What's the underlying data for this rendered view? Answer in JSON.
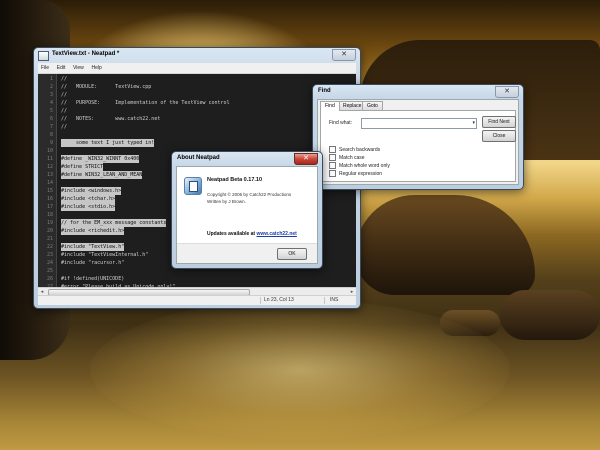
{
  "notepad": {
    "title": "TextView.txt - Neatpad *",
    "menu": [
      "File",
      "Edit",
      "View",
      "Help"
    ],
    "code_lines": [
      {
        "num": "1",
        "text": "//",
        "selected": false
      },
      {
        "num": "2",
        "text": "//   MODULE:      TextView.cpp",
        "selected": false
      },
      {
        "num": "3",
        "text": "//",
        "selected": false
      },
      {
        "num": "4",
        "text": "//   PURPOSE:     Implementation of the TextView control",
        "selected": false
      },
      {
        "num": "5",
        "text": "//",
        "selected": false
      },
      {
        "num": "6",
        "text": "//   NOTES:       www.catch22.net",
        "selected": false
      },
      {
        "num": "7",
        "text": "//",
        "selected": false
      },
      {
        "num": "8",
        "text": "",
        "selected": false
      },
      {
        "num": "9",
        "text": "     some text I just typed in!",
        "selected": true
      },
      {
        "num": "10",
        "text": "",
        "selected": false
      },
      {
        "num": "11",
        "text": "#define _WIN32_WINNT 0x400",
        "selected": true
      },
      {
        "num": "12",
        "text": "#define STRICT",
        "selected": true
      },
      {
        "num": "13",
        "text": "#define WIN32_LEAN_AND_MEAN",
        "selected": true
      },
      {
        "num": "14",
        "text": "",
        "selected": false
      },
      {
        "num": "15",
        "text": "#include <windows.h>",
        "selected": true
      },
      {
        "num": "16",
        "text": "#include <tchar.h>",
        "selected": true
      },
      {
        "num": "17",
        "text": "#include <stdio.h>",
        "selected": true
      },
      {
        "num": "18",
        "text": "",
        "selected": false
      },
      {
        "num": "19",
        "text": "// for the EM_xxx message constants",
        "selected": true
      },
      {
        "num": "20",
        "text": "#include <richedit.h>",
        "selected": true
      },
      {
        "num": "21",
        "text": "",
        "selected": false
      },
      {
        "num": "22",
        "text": "#include \"TextView.h\"",
        "selected": true
      },
      {
        "num": "23",
        "text": "#include \"TextViewInternal.h\"",
        "selected": false
      },
      {
        "num": "24",
        "text": "#include \"racursor.h\"",
        "selected": false
      },
      {
        "num": "25",
        "text": "",
        "selected": false
      },
      {
        "num": "26",
        "text": "#if !defined(UNICODE)",
        "selected": false
      },
      {
        "num": "27",
        "text": "#error \"Please build as Unicode only!\"",
        "selected": false
      },
      {
        "num": "28",
        "text": "#endif",
        "selected": false
      }
    ],
    "status": {
      "position": "Ln 23, Col 13",
      "mode": "INS"
    }
  },
  "find": {
    "title": "Find",
    "tabs": [
      "Find",
      "Replace",
      "Goto"
    ],
    "find_what_label": "Find what:",
    "find_what_value": "",
    "find_next_label": "Find Next",
    "close_label": "Close",
    "options": [
      "Search backwards",
      "Match case",
      "Match whole word only",
      "Regular expression"
    ]
  },
  "about": {
    "title": "About Neatpad",
    "app_name": "Neatpad Beta 0.17.10",
    "copyright": "Copyright © 2006 by Catch22 Productions",
    "author": "Written by J Brown.",
    "updates_text": "Updates available at",
    "updates_link": "www.catch22.net",
    "ok_label": "OK"
  },
  "colors": {
    "editor_bg": "#1e1e1e",
    "selection": "#c6c6c6",
    "link": "#1a3fa8"
  }
}
